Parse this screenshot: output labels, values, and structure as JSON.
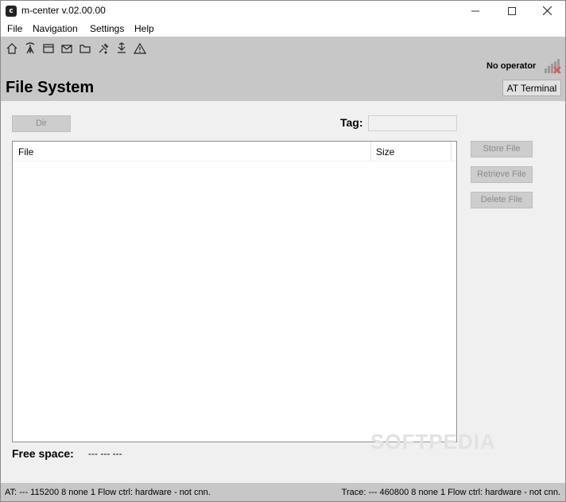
{
  "window": {
    "title": "m-center v.02.00.00",
    "app_icon": "c"
  },
  "menu": {
    "items": [
      "File",
      "Navigation",
      "Settings",
      "Help"
    ]
  },
  "toolbar": {
    "icons": [
      "home-icon",
      "antenna-icon",
      "window-icon",
      "mail-icon",
      "folder-icon",
      "connect-icon",
      "download-icon",
      "warning-icon"
    ]
  },
  "header": {
    "operator": "No operator",
    "title": "File System",
    "at_terminal": "AT Terminal"
  },
  "filesystem": {
    "dir_button": "Dir",
    "tag_label": "Tag:",
    "tag_value": "",
    "columns": [
      "File",
      "Size"
    ],
    "buttons": {
      "store": "Store File",
      "retrieve": "Retrieve File",
      "delete": "Delete File"
    },
    "free_space_label": "Free space:",
    "free_space_value": "--- --- ---"
  },
  "watermark": "SOFTPEDIA",
  "status": {
    "at": "AT: --- 115200 8 none 1 Flow ctrl: hardware - not cnn.",
    "trace": "Trace: --- 460800 8 none 1 Flow ctrl: hardware - not cnn."
  },
  "colors": {
    "toolbar_bg": "#c7c7c7",
    "content_bg": "#f0f0f0",
    "signal_error": "#e2574c"
  }
}
